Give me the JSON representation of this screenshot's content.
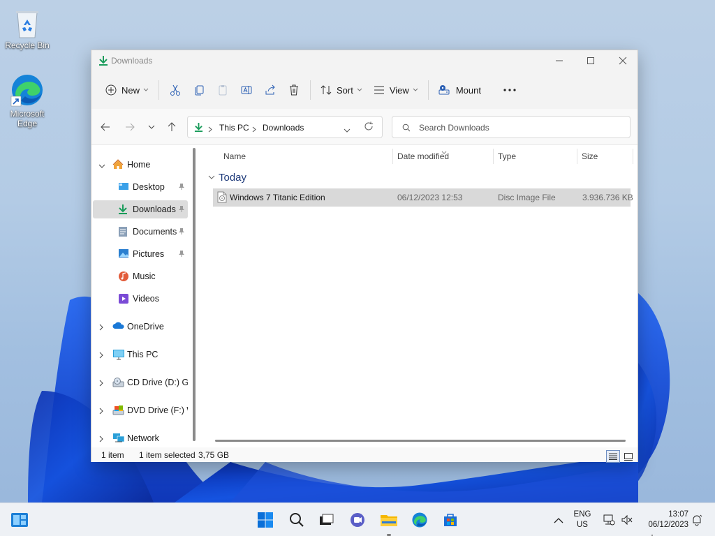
{
  "desktop": {
    "icons": [
      {
        "label": "Recycle Bin",
        "icon": "recycle-bin-icon"
      },
      {
        "label": "Microsoft Edge",
        "label_lines": [
          "Microsoft",
          "Edge"
        ],
        "icon": "edge-icon"
      }
    ]
  },
  "window": {
    "title": "Downloads",
    "title_icon": "download-arrow-icon",
    "controls": [
      "minimize-icon",
      "maximize-icon",
      "close-icon"
    ],
    "toolbar": {
      "new_label": "New",
      "sort_label": "Sort",
      "view_label": "View",
      "mount_label": "Mount",
      "icons": [
        "plus-circle-icon",
        "cut-icon",
        "copy-icon",
        "paste-icon",
        "rename-icon",
        "share-icon",
        "delete-icon",
        "sort-icon",
        "view-icon",
        "mount-icon",
        "more-icon"
      ]
    },
    "address": {
      "crumbs": [
        "This PC",
        "Downloads"
      ],
      "search_placeholder": "Search Downloads"
    },
    "nav": {
      "items": [
        {
          "label": "Home",
          "icon": "home-icon",
          "expanded": true
        },
        {
          "label": "Desktop",
          "icon": "desktop-folder-icon",
          "pinned": true
        },
        {
          "label": "Downloads",
          "icon": "downloads-folder-icon",
          "pinned": true,
          "selected": true
        },
        {
          "label": "Documents",
          "icon": "documents-folder-icon",
          "pinned": true
        },
        {
          "label": "Pictures",
          "icon": "pictures-folder-icon",
          "pinned": true
        },
        {
          "label": "Music",
          "icon": "music-folder-icon"
        },
        {
          "label": "Videos",
          "icon": "videos-folder-icon"
        },
        {
          "label": "OneDrive",
          "icon": "onedrive-icon",
          "expanded": false
        },
        {
          "label": "This PC",
          "icon": "this-pc-icon",
          "expanded": false
        },
        {
          "label": "CD Drive (D:) GSP",
          "icon": "cd-drive-icon",
          "expanded": false
        },
        {
          "label": "DVD Drive (F:) W",
          "icon": "dvd-drive-icon",
          "expanded": false
        },
        {
          "label": "Network",
          "icon": "network-icon",
          "expanded": false
        }
      ]
    },
    "columns": {
      "name": "Name",
      "date": "Date modified",
      "type": "Type",
      "size": "Size"
    },
    "group": "Today",
    "files": [
      {
        "name": "Windows 7 Titanic Edition",
        "date": "06/12/2023 12:53",
        "type": "Disc Image File",
        "size": "3.936.736 KB",
        "selected": true
      }
    ],
    "status": {
      "count": "1 item",
      "selection": "1 item selected",
      "size": "3,75 GB"
    }
  },
  "taskbar": {
    "apps": [
      "widgets-icon",
      "start-icon",
      "search-icon",
      "task-view-icon",
      "chat-icon",
      "file-explorer-icon",
      "edge-icon",
      "store-icon"
    ],
    "tray": {
      "lang_line1": "ENG",
      "lang_line2": "US",
      "time": "13:07",
      "date": "06/12/2023"
    }
  },
  "colors": {
    "accent": "#0078d4",
    "download_green": "#1a9c5b",
    "selection": "#d9d9d9"
  }
}
